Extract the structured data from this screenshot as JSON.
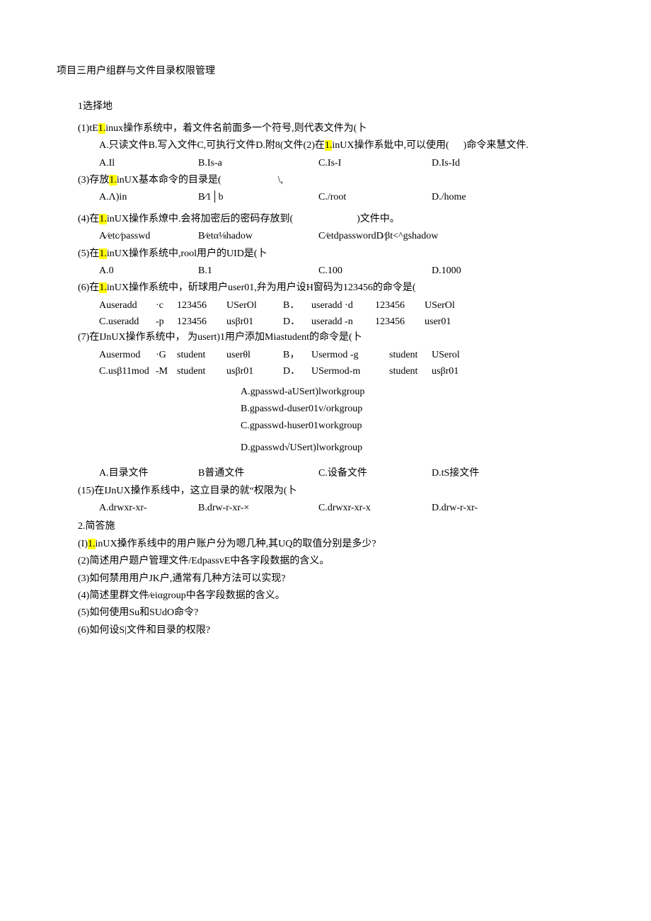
{
  "title": "项目三用户组群与文件目录权限管理",
  "section1_header": "1选择地",
  "q1": {
    "text_a": "(1)tE",
    "hl": "1.",
    "text_b": "inux操作系统中，着文件名前面多一个符号,则代表文件为(卜",
    "opts_line_a": "A.只读文件B.写入文件C,可执行文件D.附8(文件(2)在",
    "opts_hl": "1.",
    "opts_line_b": "inUX操作系妣中,可以使用(",
    "opts_line_c": ")命令来慧文件.",
    "a": "A.Il",
    "b": "B.Is-a",
    "c": "C.Is-I",
    "d": "D.Is-Id"
  },
  "q3": {
    "text_a": "(3)存放",
    "hl": "1.",
    "text_b": "inUX基本命令的目录是(",
    "text_c": "\\,",
    "a": "A.Λ)in",
    "b": "B⁄1│b",
    "c": "C./root",
    "d": "D./home"
  },
  "q4": {
    "text_a": "(4)在",
    "hl": "1.",
    "text_b": "inUX操作系燎中.会将加密后的密码存放到(",
    "text_c": ")文件中。",
    "a": "A⁄etc⁄passwd",
    "b": "B⁄etα⅛hadow",
    "c": "C⁄etdpasswordD⁄βt<^gshadow"
  },
  "q5": {
    "text_a": "(5)在",
    "hl": "1.",
    "text_b": "inUX操作系统中,rool用户的UID是(卜",
    "a": "A.0",
    "b": "B.1",
    "c": "C.100",
    "d": "D.1000"
  },
  "q6": {
    "text_a": "(6)在",
    "hl": "1.",
    "text_b": "inUX操作系统中，斫球用户user01,弁为用户设H窗码为123456的命令是(",
    "r1c1": "Auseradd",
    "r1c2": "·c",
    "r1c3": "123456",
    "r1c4": "USerOl",
    "r1c5": "B．",
    "r1c6": "useradd ·d",
    "r1c7": "123456",
    "r1c8": "USerOl",
    "r2c1": "C.useradd",
    "r2c2": "-p",
    "r2c3": "123456",
    "r2c4": "usβr01",
    "r2c5": "D．",
    "r2c6": "useradd -n",
    "r2c7": "123456",
    "r2c8": "user01"
  },
  "q7": {
    "text": "(7)在IJnUX操作系统中， 为usert)1用户添加Miastudent的命令是(卜",
    "r1c1": "Ausermod",
    "r1c2": "·G",
    "r1c3": "student",
    "r1c4": "userθl",
    "r1c5": "B，",
    "r1c6": "Usermod -g",
    "r1c7": "student",
    "r1c8": "USerol",
    "r2c1": "C.usβ11mod",
    "r2c2": "-M",
    "r2c3": "student",
    "r2c4": "usβr01",
    "r2c5": "D．",
    "r2c6": "USermod-m",
    "r2c7": "student",
    "r2c8": "usβr01"
  },
  "block": {
    "a": "A.gpasswd-aUSert)lworkgroup",
    "b": "B.gpasswd-duser01v/orkgroup",
    "c": "C.gpasswd-huser01workgroup",
    "d": "D.gpasswd√USert)lworkgroup"
  },
  "q14": {
    "a": "A.目录文件",
    "b": "B普通文件",
    "c": "C.设备文件",
    "d": "D.tS接文件"
  },
  "q15": {
    "text": "(15)在IJnUX搡作系线中，这立目录的就“权限为(卜",
    "a": "A.drwxr-xr-",
    "b": "B.drw-r-xr-×",
    "c": "C.drwxr-xr-x",
    "d": "D.drw-r-xr-"
  },
  "section2_header": "2.简答施",
  "s2q1_a": "(I)",
  "s2q1_hl": "1.",
  "s2q1_b": "inUX搡作系线中的用户账户分为嗯几种,其UQ的取值分别是多少?",
  "s2q2": "(2)简述用户题户管理文件/EdpassvE中各字段数据的含义。",
  "s2q3": "(3)如何禁用用户JK户,通常有几种方法可以实现?",
  "s2q4": "(4)简述里群文件⁄eiαgroup中各字段数据的含义。",
  "s2q5": "(5)如何使用Su和SUdO命令?",
  "s2q6": "(6)如何设S|文件和目录的权限?"
}
